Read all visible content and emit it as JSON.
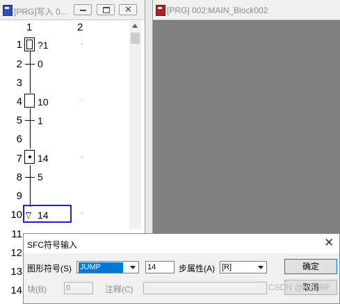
{
  "left_window": {
    "title": "[PRG]写入 0...",
    "columns": [
      "1",
      "2"
    ],
    "rows": [
      {
        "num": "1",
        "label": "?1",
        "kind": "initial-step"
      },
      {
        "num": "2",
        "label": "0",
        "kind": "transition"
      },
      {
        "num": "3",
        "label": "",
        "kind": "empty"
      },
      {
        "num": "4",
        "label": "10",
        "kind": "step"
      },
      {
        "num": "5",
        "label": "1",
        "kind": "transition"
      },
      {
        "num": "6",
        "label": "",
        "kind": "empty"
      },
      {
        "num": "7",
        "label": "14",
        "kind": "active-step"
      },
      {
        "num": "8",
        "label": "5",
        "kind": "transition"
      },
      {
        "num": "9",
        "label": "",
        "kind": "empty"
      },
      {
        "num": "10",
        "label": "14",
        "kind": "jump"
      },
      {
        "num": "11",
        "label": "",
        "kind": "empty"
      },
      {
        "num": "12",
        "label": "",
        "kind": "empty"
      },
      {
        "num": "13",
        "label": "",
        "kind": "empty"
      },
      {
        "num": "14",
        "label": "",
        "kind": "empty"
      }
    ],
    "col2_marker": "·"
  },
  "right_window": {
    "title": "[PRG] 002:MAIN_Block002"
  },
  "dialog": {
    "title": "SFC符号输入",
    "shape_label": "图形符号(S)",
    "shape_value": "JUMP",
    "step_number": "14",
    "attr_label": "步属性(A)",
    "attr_value": "[R]",
    "block_label": "块(B)",
    "block_value": "0",
    "comment_label": "注释(C)",
    "comment_value": "",
    "ok_label": "确定",
    "cancel_label": "取消",
    "watermark": "CSDN @KingRF"
  }
}
